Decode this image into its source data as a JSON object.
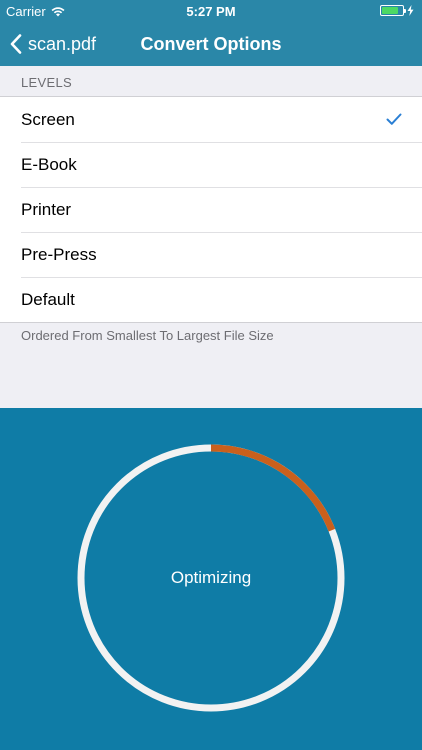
{
  "status_bar": {
    "carrier": "Carrier",
    "time": "5:27 PM",
    "battery_level": 0.8
  },
  "nav": {
    "back_label": "scan.pdf",
    "title": "Convert Options"
  },
  "levels": {
    "header": "LEVELS",
    "items": [
      {
        "label": "Screen",
        "selected": true
      },
      {
        "label": "E-Book",
        "selected": false
      },
      {
        "label": "Printer",
        "selected": false
      },
      {
        "label": "Pre-Press",
        "selected": false
      },
      {
        "label": "Default",
        "selected": false
      }
    ],
    "footer": "Ordered From Smallest To Largest File Size"
  },
  "progress": {
    "label": "Optimizing",
    "fraction": 0.19
  },
  "colors": {
    "header_bg": "#2a87a8",
    "panel_bg": "#0f7ca6",
    "ring_track": "#f2f2f2",
    "ring_progress": "#c9601c",
    "accent": "#2a7fd4"
  }
}
